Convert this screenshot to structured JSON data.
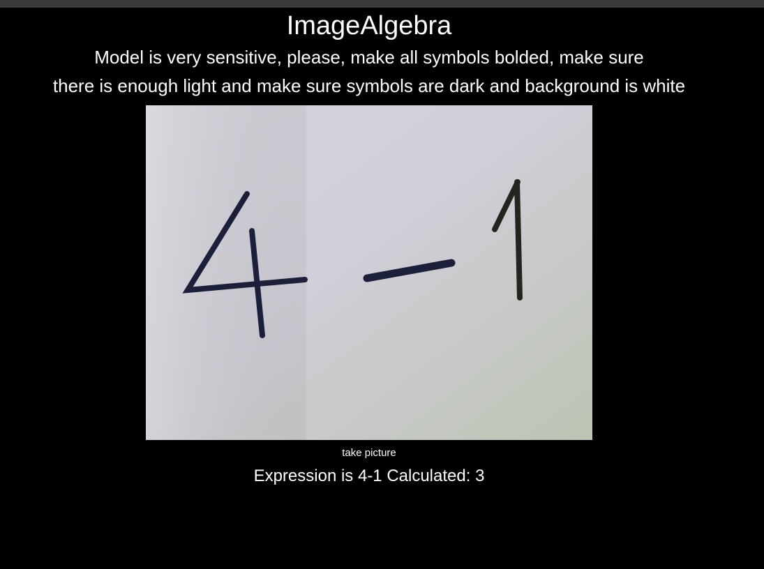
{
  "app": {
    "title": "ImageAlgebra",
    "instructions_line1": "Model is very sensitive, please, make all symbols bolded, make sure",
    "instructions_line2": "there is enough light and make sure symbols are dark and background is white"
  },
  "camera": {
    "handwritten_expression": "4 − 1",
    "ink_color": "#1c1f3a",
    "paper_color": "#d3d1d9"
  },
  "controls": {
    "take_picture_label": "take picture"
  },
  "result": {
    "text": "Expression is 4-1 Calculated: 3"
  }
}
